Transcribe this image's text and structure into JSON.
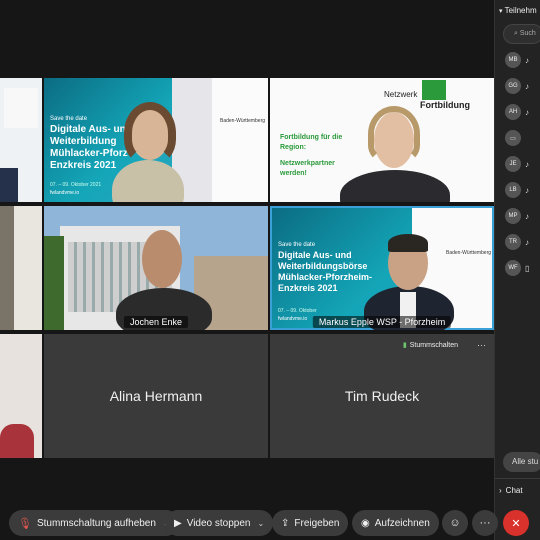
{
  "sidebar": {
    "header": "Teilnehm",
    "search_placeholder": "Such",
    "participants": [
      {
        "initials": "MB"
      },
      {
        "initials": "GG"
      },
      {
        "initials": "AH"
      },
      {
        "initials": ""
      },
      {
        "initials": "JE"
      },
      {
        "initials": "LB"
      },
      {
        "initials": "MP"
      },
      {
        "initials": "TR"
      },
      {
        "initials": "WF"
      }
    ],
    "mute_all_label": "Alle stu",
    "chat_label": "Chat"
  },
  "tiles": {
    "jochen": "Jochen Enke",
    "markus": "Markus Epple WSP - Pforzheim",
    "alina": "Alina Hermann",
    "tim": "Tim Rudeck",
    "mute_label": "Stummschalten"
  },
  "slides": {
    "save_the_date": "Save the date",
    "title_1": "Digitale Aus- und",
    "title_2": "Weiterbildung",
    "title_3": "Mühlacker-Pforz",
    "title_4": "Enzkreis 2021",
    "b_title_1": "Digitale Aus- und",
    "b_title_2": "Weiterbildungsbörse",
    "b_title_3": "Mühlacker-Pforzheim-",
    "b_title_4": "Enzkreis 2021",
    "date": "07. – 09. Oktober 2021",
    "date_short": "07. – 09. Oktober",
    "url": "fwlandvme.io",
    "brand": "Baden-Württemberg",
    "netzwerk": "Netzwerk",
    "fortbildung": "Fortbildung",
    "green_1": "Fortbildung für die",
    "green_2": "Region:",
    "green_3": "Netzwerkpartner",
    "green_4": "werden!"
  },
  "toolbar": {
    "mute_toggle": "Stummschaltung aufheben",
    "video_stop": "Video stoppen",
    "share": "Freigeben",
    "record": "Aufzeichnen"
  },
  "colors": {
    "accent_border": "#3aa0d6",
    "end_call": "#d9312b",
    "slide_teal": "#0f8ba0",
    "green_text": "#2a9a3a"
  }
}
